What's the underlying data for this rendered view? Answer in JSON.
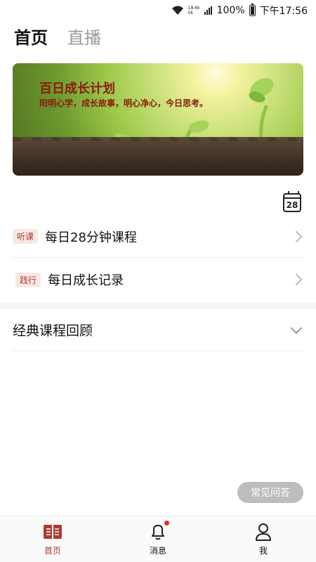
{
  "status_bar": {
    "speed_up": "18.6k",
    "speed_down": "0k",
    "battery": "100%",
    "time": "下午17:56"
  },
  "tabs": [
    {
      "label": "首页",
      "active": true
    },
    {
      "label": "直播",
      "active": false
    }
  ],
  "banner": {
    "title": "百日成长计划",
    "subtitle": "阳明心学，成长故事，明心净心，今日思考。"
  },
  "calendar": {
    "day": "28"
  },
  "menu": [
    {
      "tag": "听课",
      "label": "每日28分钟课程"
    },
    {
      "tag": "践行",
      "label": "每日成长记录"
    }
  ],
  "review": {
    "label": "经典课程回顾"
  },
  "faq_button": "常见问答",
  "bottom_nav": [
    {
      "label": "首页",
      "icon": "book-icon",
      "active": true
    },
    {
      "label": "消息",
      "icon": "bell-icon",
      "badge": true
    },
    {
      "label": "我",
      "icon": "user-icon"
    }
  ],
  "colors": {
    "accent": "#b03a2e",
    "banner_text": "#8b1a10",
    "badge": "#d9301f"
  }
}
